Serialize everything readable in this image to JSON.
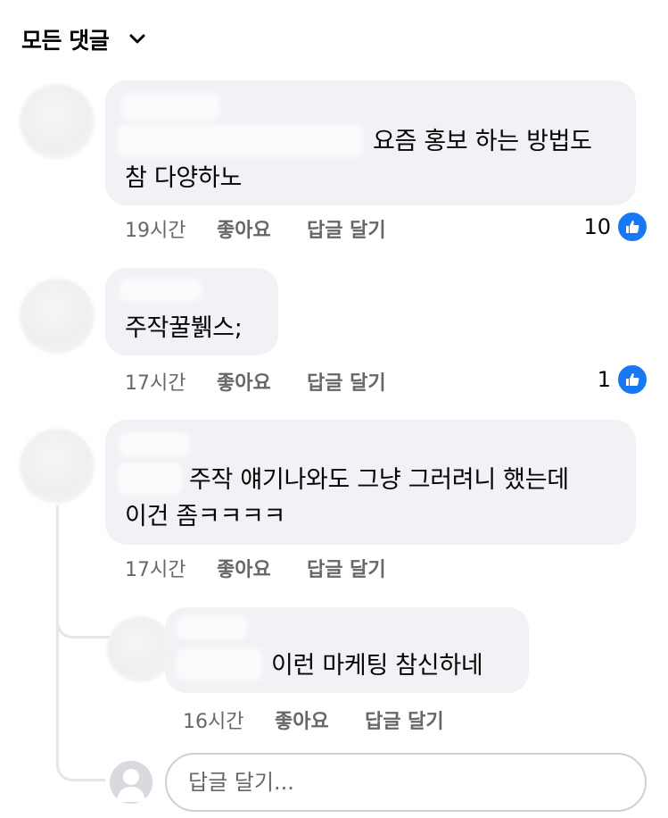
{
  "header": {
    "title": "모든 댓글"
  },
  "comments": [
    {
      "text_lines": [
        "요즘 홍보 하는 방법도",
        "참 다양하노"
      ],
      "time": "19시간",
      "like_label": "좋아요",
      "reply_label": "답글 달기",
      "reaction_count": "10",
      "reaction_icon": "like-thumb-icon"
    },
    {
      "text_lines": [
        "주작꿀뷁스;"
      ],
      "time": "17시간",
      "like_label": "좋아요",
      "reply_label": "답글 달기",
      "reaction_count": "1",
      "reaction_icon": "like-thumb-icon"
    },
    {
      "text_lines": [
        "주작 얘기나와도 그냥 그러려니 했는데",
        "이건 좀ㅋㅋㅋㅋ"
      ],
      "time": "17시간",
      "like_label": "좋아요",
      "reply_label": "답글 달기",
      "replies": [
        {
          "text_lines": [
            "이런 마케팅 참신하네"
          ],
          "time": "16시간",
          "like_label": "좋아요",
          "reply_label": "답글 달기"
        }
      ]
    }
  ],
  "reply_input": {
    "placeholder": "답글 달기..."
  },
  "colors": {
    "bubble": "#f0f2f5",
    "meta_text": "#65676b",
    "like_blue": "#1877f2"
  }
}
